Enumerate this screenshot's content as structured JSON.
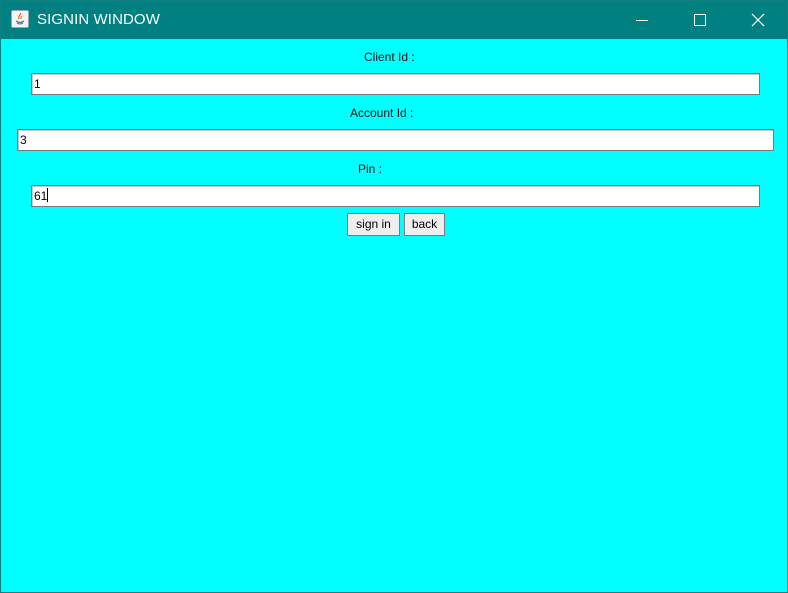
{
  "window": {
    "title": "SIGNIN WINDOW",
    "icon": "java-app-icon",
    "controls": {
      "minimize": "minimize-icon",
      "maximize": "maximize-icon",
      "close": "close-icon"
    },
    "colors": {
      "titlebar": "#008080",
      "background": "#00ffff"
    }
  },
  "form": {
    "client_id": {
      "label": "Client Id :",
      "value": "1"
    },
    "account_id": {
      "label": "Account Id :",
      "value": "3"
    },
    "pin": {
      "label": "Pin :",
      "value": "61"
    }
  },
  "buttons": {
    "sign_in": "sign in",
    "back": "back"
  }
}
